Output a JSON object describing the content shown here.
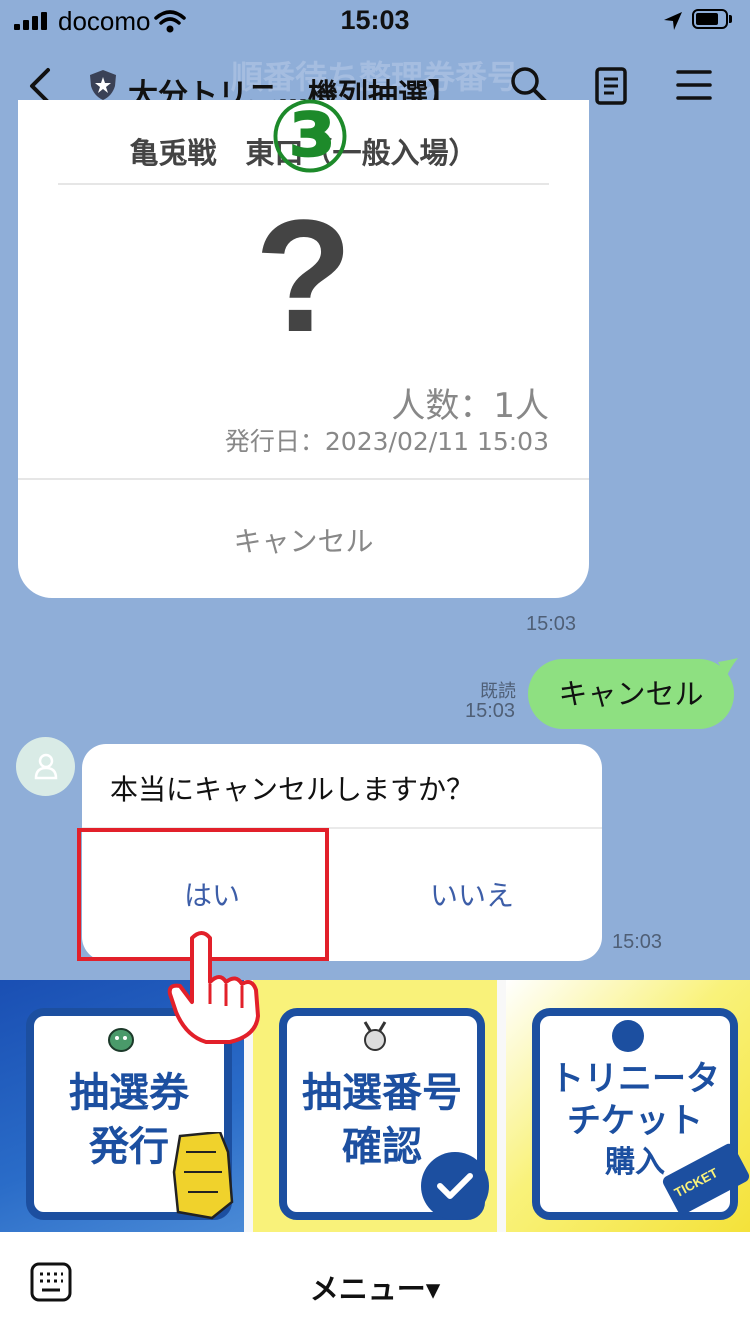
{
  "status_bar": {
    "carrier": "docomo",
    "time": "15:03"
  },
  "header": {
    "title": "大分トリニ…機列抽選】",
    "background_caption": "順番待ち整理券番号"
  },
  "ticket_card": {
    "match_line": "亀兎戦　東口（一般入場）",
    "number": "?",
    "count": "人数：1人",
    "issued": "発行日：2023/02/11 15:03",
    "cancel_label": "キャンセル",
    "time": "15:03"
  },
  "annotation": {
    "step": "③"
  },
  "sent_message": {
    "read_label": "既読",
    "time": "15:03",
    "text": "キャンセル"
  },
  "confirm_message": {
    "question": "本当にキャンセルしますか？",
    "yes_label": "はい",
    "no_label": "いいえ",
    "time": "15:03"
  },
  "rich_menu": {
    "tiles": [
      {
        "text_line1": "抽選券",
        "text_line2": "発行"
      },
      {
        "text_line1": "抽選番号",
        "text_line2": "確認"
      },
      {
        "text_line1": "トリニータ",
        "text_line2": "チケット",
        "text_line3": "購入",
        "ticket_word": "TICKET"
      }
    ]
  },
  "bottom_bar": {
    "menu_label": "メニュー▾"
  },
  "colors": {
    "chat_bg": "#8faed8",
    "sent_bubble": "#8ee081",
    "accent_blue": "#1c4fa0",
    "highlight_red": "#e2202a",
    "annotation_green": "#1d8a2a"
  }
}
